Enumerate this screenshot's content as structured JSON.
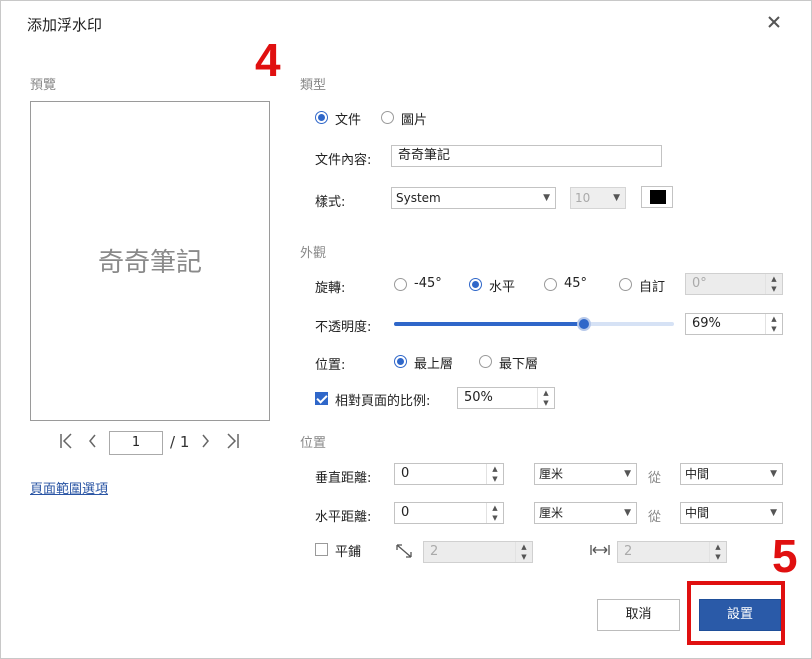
{
  "dialog": {
    "title": "添加浮水印"
  },
  "preview": {
    "label": "預覽",
    "text": "奇奇筆記",
    "page": "1",
    "total": "/ 1",
    "range_link": "頁面範圍選項"
  },
  "type_section": {
    "label": "類型",
    "radio_text": "文件",
    "radio_image": "圖片",
    "selected": "文件",
    "content_label": "文件內容:",
    "content_value": "奇奇筆記",
    "style_label": "樣式:",
    "font": "System",
    "size": "10",
    "color": "#000000"
  },
  "appearance": {
    "label": "外觀",
    "rotate_label": "旋轉:",
    "rot_neg45": "-45°",
    "rot_horizontal": "水平",
    "rot_45": "45°",
    "rot_custom": "自訂",
    "rot_custom_value": "0°",
    "selected_rotation": "水平",
    "opacity_label": "不透明度:",
    "opacity_value": "69%",
    "opacity_fraction": 0.69,
    "position_label": "位置:",
    "pos_top": "最上層",
    "pos_bottom": "最下層",
    "selected_position": "最上層",
    "scale_label": "相對頁面的比例:",
    "scale_checked": true,
    "scale_value": "50%"
  },
  "position": {
    "label": "位置",
    "vertical_label": "垂直距離:",
    "vertical_value": "0",
    "vertical_unit": "厘米",
    "vertical_from": "從",
    "vertical_anchor": "中間",
    "horizontal_label": "水平距離:",
    "horizontal_value": "0",
    "horizontal_unit": "厘米",
    "horizontal_from": "從",
    "horizontal_anchor": "中間",
    "tile_label": "平鋪",
    "tile_checked": false,
    "tile_value1": "2",
    "tile_value2": "2"
  },
  "buttons": {
    "cancel": "取消",
    "set": "設置"
  },
  "annotations": {
    "step4": "4",
    "step5": "5",
    "accent": "#e01010"
  }
}
